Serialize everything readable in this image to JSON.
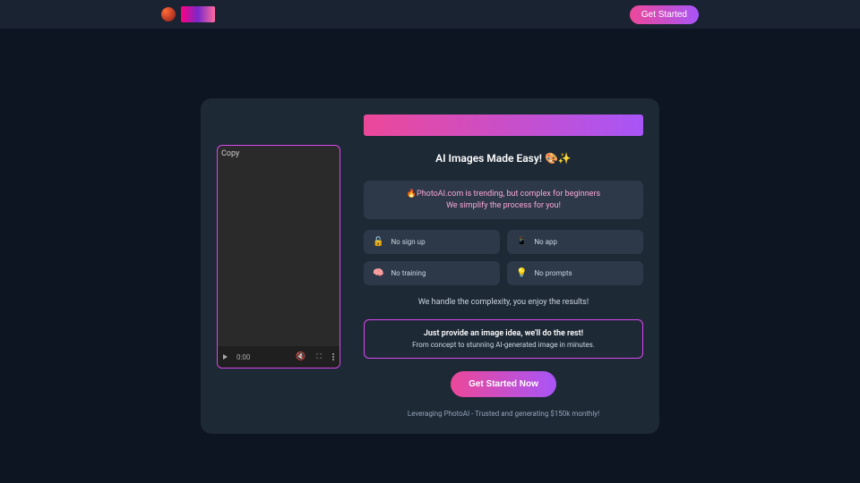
{
  "header": {
    "get_started": "Get Started"
  },
  "video": {
    "copy_label": "Copy",
    "time": "0:00"
  },
  "content": {
    "heading": "AI Images Made Easy! 🎨✨",
    "info_line1": "🔥PhotoAI.com is trending, but complex for beginners",
    "info_line2": "We simplify the process for you!",
    "features": [
      {
        "emoji": "🔓",
        "label": "No sign up"
      },
      {
        "emoji": "📱",
        "label": "No app"
      },
      {
        "emoji": "🧠",
        "label": "No training"
      },
      {
        "emoji": "💡",
        "label": "No prompts"
      }
    ],
    "tagline": "We handle the complexity, you enjoy the results!",
    "cta_title": "Just provide an image idea, we'll do the rest!",
    "cta_sub": "From concept to stunning AI-generated image in minutes.",
    "big_btn": "Get Started Now",
    "footer": "Leveraging PhotoAI - Trusted and generating $150k monthly!"
  }
}
